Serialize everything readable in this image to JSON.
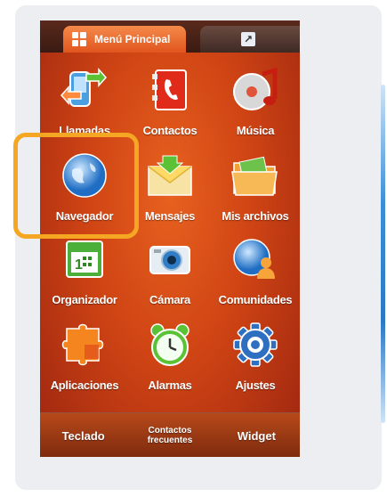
{
  "tabs": {
    "main_label": "Menú Principal",
    "main_icon": "grid-icon",
    "second_icon": "widget-icon"
  },
  "apps": [
    {
      "label": "Llamadas",
      "icon": "phone-call-icon"
    },
    {
      "label": "Contactos",
      "icon": "contacts-book-icon"
    },
    {
      "label": "Música",
      "icon": "music-disc-icon"
    },
    {
      "label": "Navegador",
      "icon": "globe-icon"
    },
    {
      "label": "Mensajes",
      "icon": "envelope-icon"
    },
    {
      "label": "Mis archivos",
      "icon": "folder-icon"
    },
    {
      "label": "Organizador",
      "icon": "calendar-icon"
    },
    {
      "label": "Cámara",
      "icon": "camera-icon"
    },
    {
      "label": "Comunidades",
      "icon": "community-globe-icon"
    },
    {
      "label": "Aplicaciones",
      "icon": "puzzle-icon"
    },
    {
      "label": "Alarmas",
      "icon": "alarm-clock-icon"
    },
    {
      "label": "Ajustes",
      "icon": "gear-icon"
    }
  ],
  "bottom_bar": {
    "left": "Teclado",
    "center_line1": "Contactos",
    "center_line2": "frecuentes",
    "right": "Widget"
  },
  "colors": {
    "highlight": "#f5a623",
    "background": "#cf4414"
  }
}
